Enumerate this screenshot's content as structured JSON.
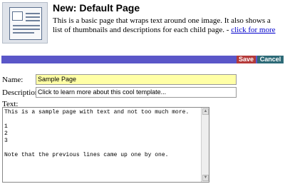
{
  "header": {
    "title": "New: Default Page",
    "description": "This is a basic page that wraps text around one image. It also shows a list of thumbnails and descriptions for each child page.",
    "separator": " - ",
    "link_label": "click for more",
    "thumbnail_icon": "page-layout-icon"
  },
  "toolbar": {
    "bar_color": "#5a56c8",
    "save_label": "Save",
    "cancel_label": "Cancel"
  },
  "form": {
    "name_label": "Name:",
    "name_value": "Sample Page",
    "description_label": "Description:",
    "description_value": "Click to learn more about this cool template...",
    "text_label": "Text:",
    "text_lines": [
      "This is a sample page with text and not too much more.",
      "",
      "1",
      "2",
      "3",
      "",
      "Note that the previous lines came up one by one."
    ]
  }
}
